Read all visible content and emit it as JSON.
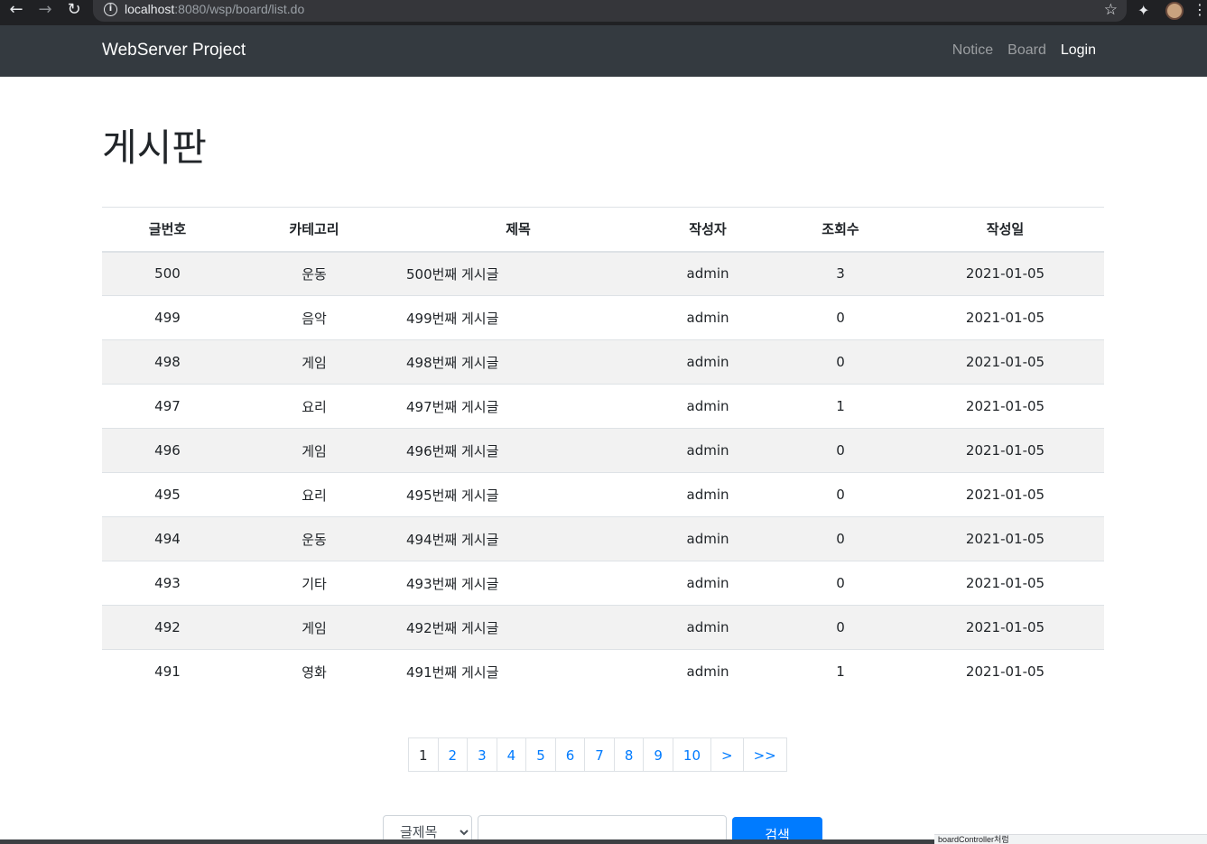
{
  "browser": {
    "url_host": "localhost",
    "url_rest": ":8080/wsp/board/list.do"
  },
  "navbar": {
    "brand": "WebServer Project",
    "links": [
      "Notice",
      "Board",
      "Login"
    ]
  },
  "page": {
    "title": "게시판"
  },
  "table": {
    "headers": [
      "글번호",
      "카테고리",
      "제목",
      "작성자",
      "조회수",
      "작성일"
    ],
    "rows": [
      {
        "no": "500",
        "category": "운동",
        "title": "500번째 게시글",
        "writer": "admin",
        "hits": "3",
        "date": "2021-01-05"
      },
      {
        "no": "499",
        "category": "음악",
        "title": "499번째 게시글",
        "writer": "admin",
        "hits": "0",
        "date": "2021-01-05"
      },
      {
        "no": "498",
        "category": "게임",
        "title": "498번째 게시글",
        "writer": "admin",
        "hits": "0",
        "date": "2021-01-05"
      },
      {
        "no": "497",
        "category": "요리",
        "title": "497번째 게시글",
        "writer": "admin",
        "hits": "1",
        "date": "2021-01-05"
      },
      {
        "no": "496",
        "category": "게임",
        "title": "496번째 게시글",
        "writer": "admin",
        "hits": "0",
        "date": "2021-01-05"
      },
      {
        "no": "495",
        "category": "요리",
        "title": "495번째 게시글",
        "writer": "admin",
        "hits": "0",
        "date": "2021-01-05"
      },
      {
        "no": "494",
        "category": "운동",
        "title": "494번째 게시글",
        "writer": "admin",
        "hits": "0",
        "date": "2021-01-05"
      },
      {
        "no": "493",
        "category": "기타",
        "title": "493번째 게시글",
        "writer": "admin",
        "hits": "0",
        "date": "2021-01-05"
      },
      {
        "no": "492",
        "category": "게임",
        "title": "492번째 게시글",
        "writer": "admin",
        "hits": "0",
        "date": "2021-01-05"
      },
      {
        "no": "491",
        "category": "영화",
        "title": "491번째 게시글",
        "writer": "admin",
        "hits": "1",
        "date": "2021-01-05"
      }
    ]
  },
  "pagination": {
    "pages": [
      "1",
      "2",
      "3",
      "4",
      "5",
      "6",
      "7",
      "8",
      "9",
      "10",
      ">",
      ">>"
    ],
    "current": "1"
  },
  "search": {
    "select_value": "글제목",
    "input_value": "",
    "button_label": "검색"
  },
  "status_bar": {
    "text": "boardController처럼"
  }
}
